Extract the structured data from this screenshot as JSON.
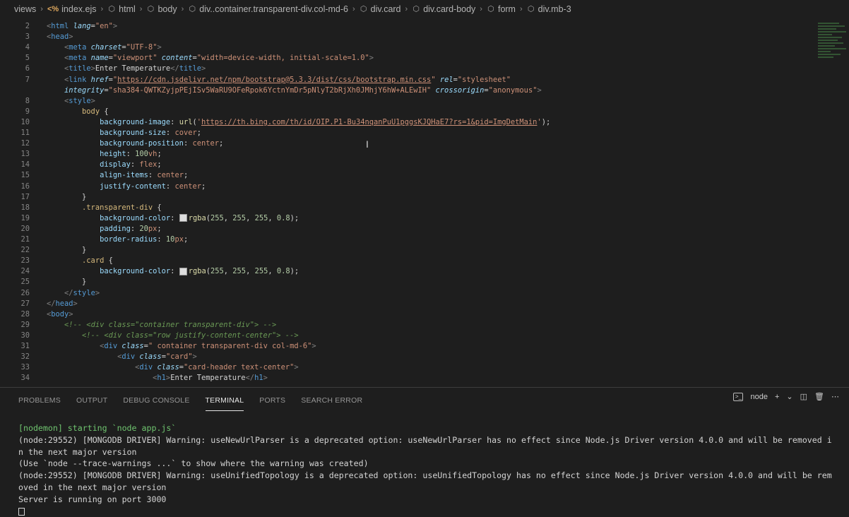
{
  "breadcrumb": {
    "items": [
      {
        "label": "views",
        "icon": "none"
      },
      {
        "label": "index.ejs",
        "icon": "ejs-file-icon"
      },
      {
        "label": "html",
        "icon": "cube-icon"
      },
      {
        "label": "body",
        "icon": "cube-icon"
      },
      {
        "label": "div..container.transparent-div.col-md-6",
        "icon": "cube-icon"
      },
      {
        "label": "div.card",
        "icon": "cube-icon"
      },
      {
        "label": "div.card-body",
        "icon": "cube-icon"
      },
      {
        "label": "form",
        "icon": "cube-icon"
      },
      {
        "label": "div.mb-3",
        "icon": "cube-icon"
      }
    ],
    "ejs_marker": "<%"
  },
  "editor": {
    "lines": [
      {
        "n": "2",
        "html": "<span class='t-brk'>&lt;</span><span class='t-tag'>html</span> <span class='t-attr'>lang</span>=<span class='t-str'>\"en\"</span><span class='t-brk'>&gt;</span>"
      },
      {
        "n": "3",
        "html": "<span class='t-brk'>&lt;</span><span class='t-tag'>head</span><span class='t-brk'>&gt;</span>"
      },
      {
        "n": "4",
        "html": "    <span class='t-brk'>&lt;</span><span class='t-tag'>meta</span> <span class='t-attr'>charset</span>=<span class='t-str'>\"UTF-8\"</span><span class='t-brk'>&gt;</span>"
      },
      {
        "n": "5",
        "html": "    <span class='t-brk'>&lt;</span><span class='t-tag'>meta</span> <span class='t-attr'>name</span>=<span class='t-str'>\"viewport\"</span> <span class='t-attr'>content</span>=<span class='t-str'>\"width=device-width, initial-scale=1.0\"</span><span class='t-brk'>&gt;</span>"
      },
      {
        "n": "6",
        "html": "    <span class='t-brk'>&lt;</span><span class='t-tag'>title</span><span class='t-brk'>&gt;</span>Enter Temperature<span class='t-brk'>&lt;/</span><span class='t-tag'>title</span><span class='t-brk'>&gt;</span>"
      },
      {
        "n": "7",
        "html": "    <span class='t-brk'>&lt;</span><span class='t-tag'>link</span> <span class='t-attr'>href</span>=<span class='t-str'>\"<span class='t-url'>https://cdn.jsdelivr.net/npm/bootstrap@5.3.3/dist/css/bootstrap.min.css</span>\"</span> <span class='t-attr'>rel</span>=<span class='t-str'>\"stylesheet\"</span>"
      },
      {
        "n": "",
        "html": "    <span class='t-attr'>integrity</span>=<span class='t-str'>\"sha384-QWTKZyjpPEjISv5WaRU9OFeRpok6YctnYmDr5pNlyT2bRjXh0JMhjY6hW+ALEwIH\"</span> <span class='t-attr'>crossorigin</span>=<span class='t-str'>\"anonymous\"</span><span class='t-brk'>&gt;</span>"
      },
      {
        "n": "8",
        "html": "    <span class='t-brk'>&lt;</span><span class='t-tag'>style</span><span class='t-brk'>&gt;</span>"
      },
      {
        "n": "9",
        "html": "        <span class='t-sel'>body</span> {"
      },
      {
        "n": "10",
        "html": "            <span class='t-prop'>background-image</span>: <span class='t-fn'>url</span>(<span class='t-str'>'<span class='t-url'>https://th.bing.com/th/id/OIP.P1-Bu34nqanPuU1pggsKJQHaE7?rs=1&amp;pid=ImgDetMain</span>'</span>);"
      },
      {
        "n": "11",
        "html": "            <span class='t-prop'>background-size</span>: <span class='t-val'>cover</span>;"
      },
      {
        "n": "12",
        "html": "            <span class='t-prop'>background-position</span>: <span class='t-val'>center</span>;"
      },
      {
        "n": "13",
        "html": "            <span class='t-prop'>height</span>: <span class='t-num'>100</span><span class='t-val'>vh</span>;"
      },
      {
        "n": "14",
        "html": "            <span class='t-prop'>display</span>: <span class='t-val'>flex</span>;"
      },
      {
        "n": "15",
        "html": "            <span class='t-prop'>align-items</span>: <span class='t-val'>center</span>;"
      },
      {
        "n": "16",
        "html": "            <span class='t-prop'>justify-content</span>: <span class='t-val'>center</span>;"
      },
      {
        "n": "17",
        "html": "        }"
      },
      {
        "n": "18",
        "html": "        <span class='t-sel'>.transparent-div</span> {"
      },
      {
        "n": "19",
        "html": "            <span class='t-prop'>background-color</span>: <span class='swatch'></span><span class='t-fn'>rgba</span>(<span class='t-num'>255</span>, <span class='t-num'>255</span>, <span class='t-num'>255</span>, <span class='t-num'>0.8</span>);"
      },
      {
        "n": "20",
        "html": "            <span class='t-prop'>padding</span>: <span class='t-num'>20</span><span class='t-val'>px</span>;"
      },
      {
        "n": "21",
        "html": "            <span class='t-prop'>border-radius</span>: <span class='t-num'>10</span><span class='t-val'>px</span>;"
      },
      {
        "n": "22",
        "html": "        }"
      },
      {
        "n": "23",
        "html": "        <span class='t-sel'>.card</span> {"
      },
      {
        "n": "24",
        "html": "            <span class='t-prop'>background-color</span>: <span class='swatch'></span><span class='t-fn'>rgba</span>(<span class='t-num'>255</span>, <span class='t-num'>255</span>, <span class='t-num'>255</span>, <span class='t-num'>0.8</span>);"
      },
      {
        "n": "25",
        "html": "        }"
      },
      {
        "n": "26",
        "html": "    <span class='t-brk'>&lt;/</span><span class='t-tag'>style</span><span class='t-brk'>&gt;</span>"
      },
      {
        "n": "27",
        "html": "<span class='t-brk'>&lt;/</span><span class='t-tag'>head</span><span class='t-brk'>&gt;</span>"
      },
      {
        "n": "28",
        "html": "<span class='t-brk'>&lt;</span><span class='t-tag'>body</span><span class='t-brk'>&gt;</span>"
      },
      {
        "n": "29",
        "html": "    <span class='t-com'>&lt;!-- &lt;div class=\"container transparent-div\"&gt; --&gt;</span>"
      },
      {
        "n": "30",
        "html": "        <span class='t-com'>&lt;!-- &lt;div class=\"row justify-content-center\"&gt; --&gt;</span>"
      },
      {
        "n": "31",
        "html": "            <span class='t-brk'>&lt;</span><span class='t-tag'>div</span> <span class='t-attr'>class</span>=<span class='t-str'>\" container transparent-div col-md-6\"</span><span class='t-brk'>&gt;</span>"
      },
      {
        "n": "32",
        "html": "                <span class='t-brk'>&lt;</span><span class='t-tag'>div</span> <span class='t-attr'>class</span>=<span class='t-str'>\"card\"</span><span class='t-brk'>&gt;</span>"
      },
      {
        "n": "33",
        "html": "                    <span class='t-brk'>&lt;</span><span class='t-tag'>div</span> <span class='t-attr'>class</span>=<span class='t-str'>\"card-header text-center\"</span><span class='t-brk'>&gt;</span>"
      },
      {
        "n": "34",
        "html": "                        <span class='t-brk'>&lt;</span><span class='t-tag'>h1</span><span class='t-brk'>&gt;</span>Enter Temperature<span class='t-brk'>&lt;/</span><span class='t-tag'>h1</span><span class='t-brk'>&gt;</span>"
      }
    ]
  },
  "panel": {
    "tabs": [
      "PROBLEMS",
      "OUTPUT",
      "DEBUG CONSOLE",
      "TERMINAL",
      "PORTS",
      "SEARCH ERROR"
    ],
    "active_tab": "TERMINAL",
    "terminal_name": "node"
  },
  "terminal": {
    "lines": [
      {
        "text": "[nodemon] starting `node app.js`",
        "color": "green"
      },
      {
        "text": "(node:29552) [MONGODB DRIVER] Warning: useNewUrlParser is a deprecated option: useNewUrlParser has no effect since Node.js Driver version 4.0.0 and will be removed i",
        "color": "default"
      },
      {
        "text": "n the next major version",
        "color": "default"
      },
      {
        "text": "(Use `node --trace-warnings ...` to show where the warning was created)",
        "color": "default"
      },
      {
        "text": "(node:29552) [MONGODB DRIVER] Warning: useUnifiedTopology is a deprecated option: useUnifiedTopology has no effect since Node.js Driver version 4.0.0 and will be rem",
        "color": "default"
      },
      {
        "text": "oved in the next major version",
        "color": "default"
      },
      {
        "text": "Server is running on port 3000",
        "color": "default"
      }
    ]
  }
}
